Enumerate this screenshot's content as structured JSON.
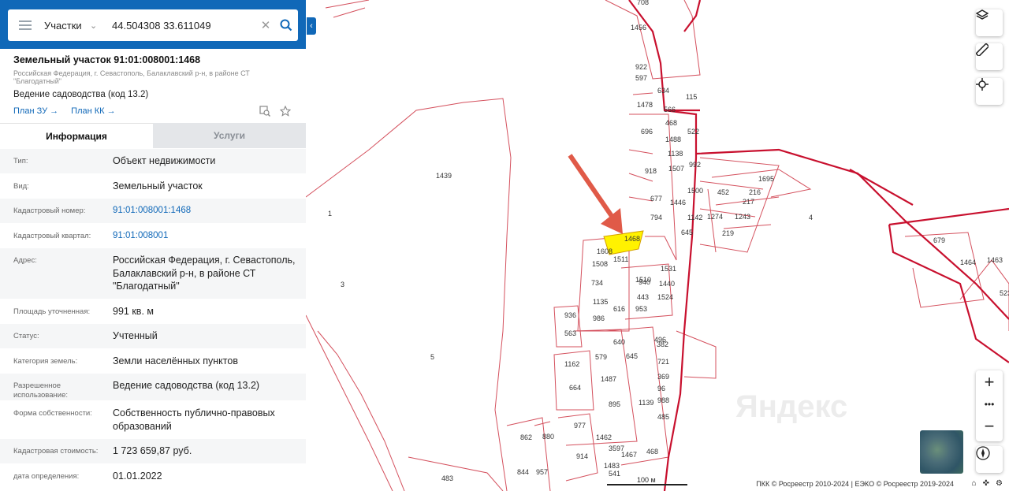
{
  "search": {
    "type": "Участки",
    "value": "44.504308 33.611049"
  },
  "parcel": {
    "title": "Земельный участок 91:01:008001:1468",
    "address_short": "Российская Федерация, г. Севастополь, Балаклавский р-н, в районе СТ \"Благодатный\"",
    "use": "Ведение садоводства (код 13.2)",
    "plan_zu": "План ЗУ",
    "plan_kk": "План КК"
  },
  "tabs": {
    "info": "Информация",
    "services": "Услуги"
  },
  "info": [
    {
      "k": "Тип:",
      "v": "Объект недвижимости"
    },
    {
      "k": "Вид:",
      "v": "Земельный участок"
    },
    {
      "k": "Кадастровый номер:",
      "v": "91:01:008001:1468"
    },
    {
      "k": "Кадастровый квартал:",
      "v": "91:01:008001"
    },
    {
      "k": "Адрес:",
      "v": "Российская Федерация, г. Севастополь, Балаклавский р-н, в районе СТ \"Благодатный\""
    },
    {
      "k": "Площадь уточненная:",
      "v": "991 кв. м"
    },
    {
      "k": "Статус:",
      "v": "Учтенный"
    },
    {
      "k": "Категория земель:",
      "v": "Земли населённых пунктов"
    },
    {
      "k": "Разрешенное использование:",
      "v": "Ведение садоводства (код 13.2)"
    },
    {
      "k": "Форма собственности:",
      "v": "Собственность публично-правовых образований"
    },
    {
      "k": "Кадастровая стоимость:",
      "v": "1 723 659,87 руб."
    },
    {
      "k": "дата определения:",
      "v": "01.01.2022"
    }
  ],
  "map": {
    "labels": [
      "708",
      "1456",
      "922",
      "597",
      "634",
      "566",
      "115",
      "1478",
      "696",
      "468",
      "1488",
      "522",
      "1138",
      "1507",
      "992",
      "918",
      "1695",
      "452",
      "216",
      "217",
      "1500",
      "1446",
      "1142",
      "1243",
      "1274",
      "677",
      "794",
      "219",
      "645",
      "679",
      "1464",
      "1463",
      "523",
      "1468",
      "1608",
      "1508",
      "1531",
      "1511",
      "1510",
      "940",
      "1440",
      "734",
      "443",
      "1524",
      "1135",
      "616",
      "953",
      "936",
      "986",
      "563",
      "640",
      "382",
      "496",
      "1162",
      "579",
      "645",
      "721",
      "369",
      "664",
      "1487",
      "96",
      "895",
      "1139",
      "988",
      "977",
      "485",
      "862",
      "880",
      "1462",
      "3597",
      "1467",
      "468",
      "844",
      "957",
      "914",
      "1483",
      "541",
      "483",
      "1439",
      "1",
      "3",
      "5",
      "4"
    ],
    "scale": "100 м",
    "copyright": "ПКК © Росреестр 2010-2024 | ЕЭКО © Росреестр 2019-2024",
    "watermark": "Яндекс",
    "colors": {
      "boundary": "#c8102e",
      "parcel_line": "#d4505d",
      "highlight": "#fff200",
      "arrow": "#e05a48"
    }
  }
}
